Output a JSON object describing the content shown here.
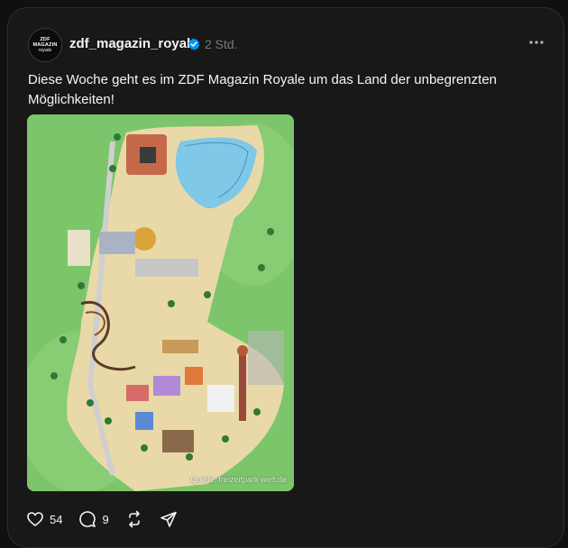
{
  "post": {
    "avatar_text": {
      "line1": "ZDF",
      "line2": "MAGAZIN",
      "line3": "royale"
    },
    "username": "zdf_magazin_royale",
    "time": "2 Std.",
    "caption": "Diese Woche geht es im ZDF Magazin Royale um das Land der unbegrenzten Möglichkeiten!",
    "image_credit": "Quelle: freizeitpark-welt.de"
  },
  "actions": {
    "likes": "54",
    "comments": "9"
  },
  "colors": {
    "background": "#101010",
    "card": "#181818",
    "text": "#f3f5f7",
    "muted": "#777777",
    "verified": "#0095f6"
  },
  "icons": [
    "verified-badge-icon",
    "more-icon",
    "heart-icon",
    "comment-icon",
    "repost-icon",
    "share-icon"
  ]
}
